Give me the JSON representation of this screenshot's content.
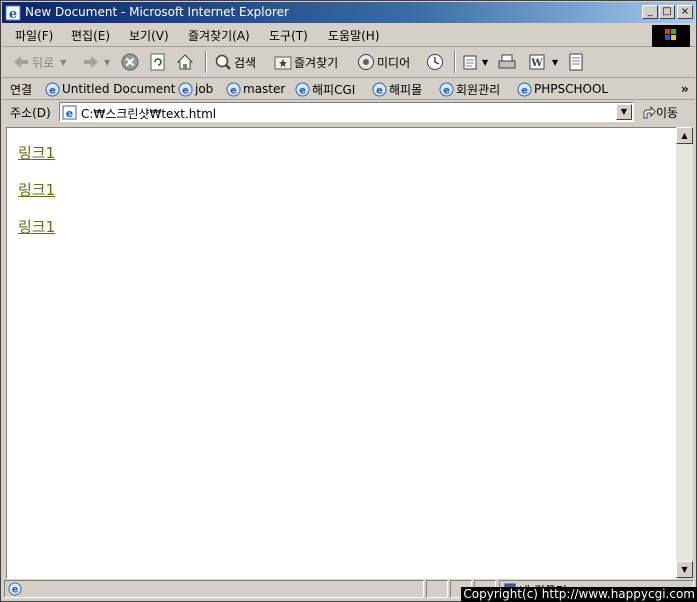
{
  "window": {
    "title": "New Document - Microsoft Internet Explorer"
  },
  "menu": [
    "파일(F)",
    "편집(E)",
    "보기(V)",
    "즐겨찾기(A)",
    "도구(T)",
    "도움말(H)"
  ],
  "toolbar": {
    "back": "뒤로",
    "search": "검색",
    "favorites": "즐겨찾기",
    "media": "미디어"
  },
  "links": {
    "label": "연결",
    "items": [
      "Untitled Document",
      "job",
      "master",
      "해피CGI",
      "해피몰",
      "회원관리",
      "PHPSCHOOL"
    ],
    "more": "»"
  },
  "address": {
    "label": "주소(D)",
    "url": "C:₩스크린샷₩text.html",
    "go": "이동"
  },
  "page": {
    "links": [
      "링크1",
      "링크1",
      "링크1"
    ]
  },
  "status": {
    "zone": "내 컴퓨터",
    "copyright": "Copyright(c) http://www.happycgi.com"
  },
  "colors": {
    "visited_link": "#6b6b1a",
    "title_start": "#0a246a",
    "title_end": "#a6caf0"
  }
}
